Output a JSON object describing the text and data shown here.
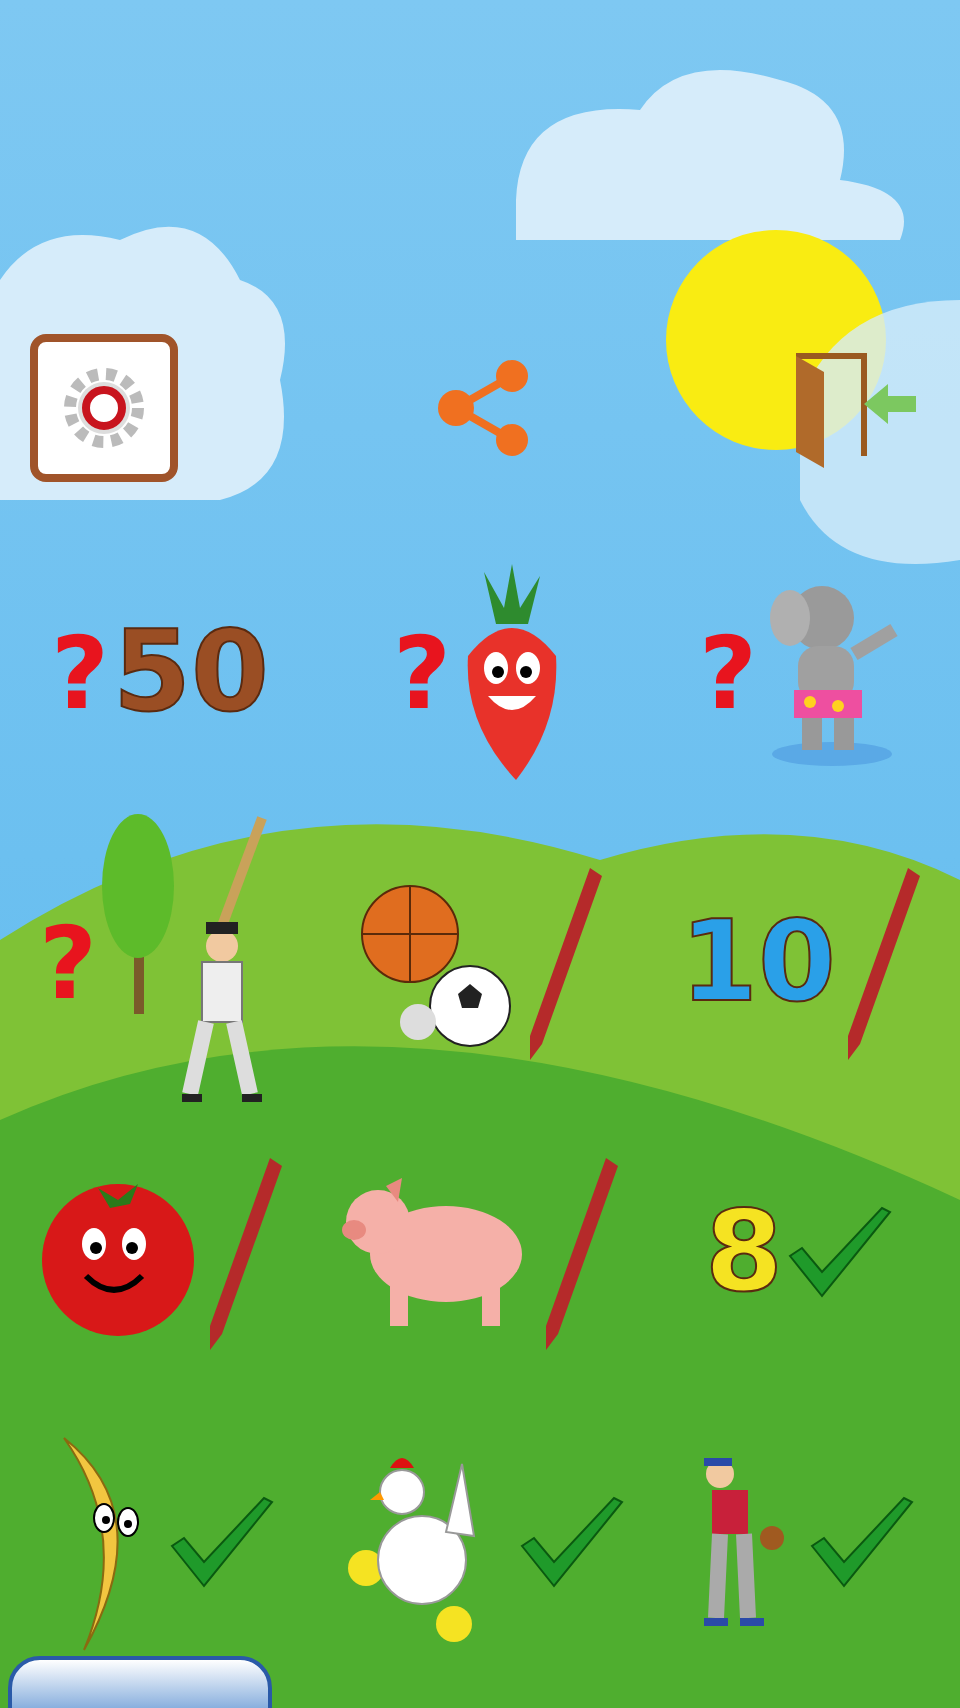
{
  "toolbar": {
    "buttons": [
      {
        "kind": "settings"
      },
      {
        "kind": "share"
      },
      {
        "kind": "exit"
      }
    ]
  },
  "tiles": [
    {
      "kind": "question",
      "mark": "?",
      "label": "50"
    },
    {
      "kind": "question",
      "mark": "?"
    },
    {
      "kind": "question",
      "mark": "?"
    },
    {
      "kind": "question",
      "mark": "?"
    },
    {
      "kind": "pencil"
    },
    {
      "kind": "pencil",
      "label": "10"
    },
    {
      "kind": "pencil"
    },
    {
      "kind": "pencil"
    },
    {
      "kind": "check",
      "label": "8"
    },
    {
      "kind": "check"
    },
    {
      "kind": "check"
    },
    {
      "kind": "check"
    }
  ]
}
